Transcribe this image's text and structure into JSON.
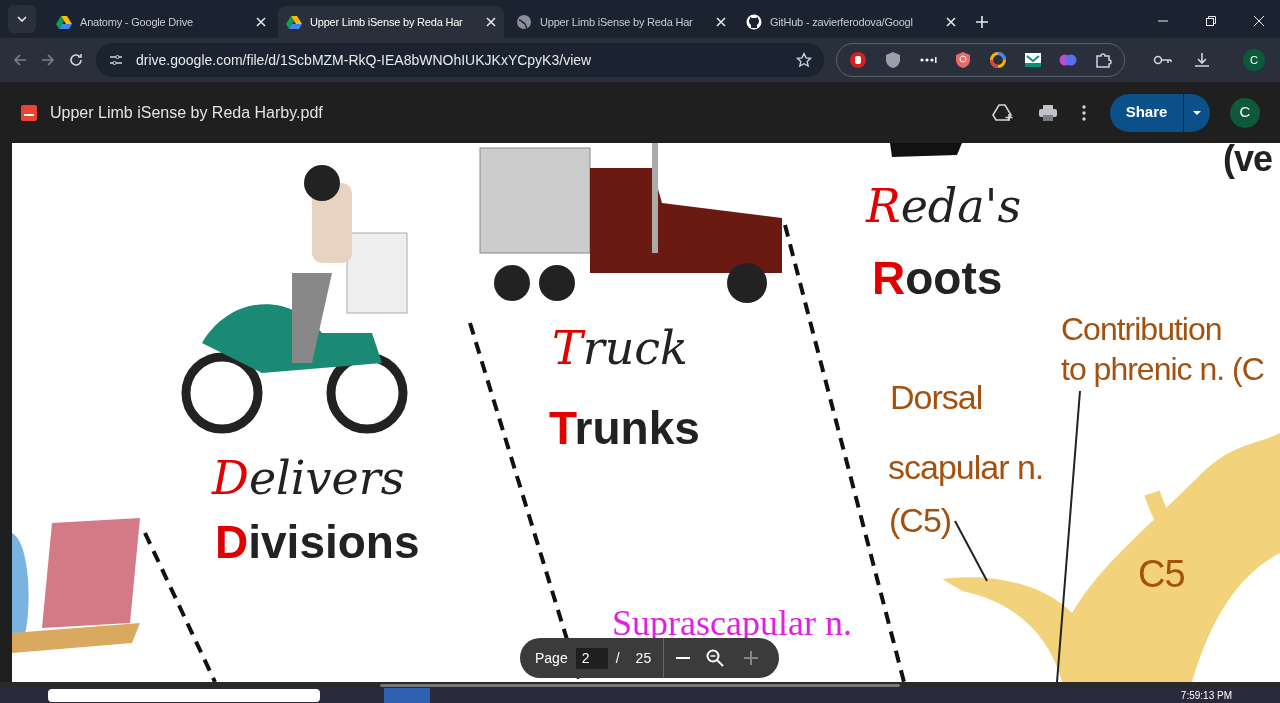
{
  "tabs": [
    {
      "title": "Anatomy - Google Drive",
      "kind": "drive",
      "selected": false
    },
    {
      "title": "Upper Limb iSense by Reda Har",
      "kind": "drive",
      "selected": true
    },
    {
      "title": "Upper Limb iSense by Reda Har",
      "kind": "globe",
      "selected": false
    },
    {
      "title": "GitHub - zavierferodova/Googl",
      "kind": "github",
      "selected": false
    }
  ],
  "address_bar": {
    "url": "drive.google.com/file/d/1ScbMZM-RkQ-IEA8bWNOhIUKJKxYCpyK3/view"
  },
  "extensions": [
    {
      "kind": "hand"
    },
    {
      "kind": "shield"
    },
    {
      "kind": "dots"
    },
    {
      "kind": "shield-red"
    },
    {
      "kind": "ring"
    },
    {
      "kind": "mail"
    },
    {
      "kind": "brain"
    },
    {
      "kind": "puzzle"
    }
  ],
  "profile_initial": "C",
  "viewer": {
    "file_name": "Upper Limb iSense by Reda Harby.pdf",
    "share_label": "Share",
    "avatar_initial": "C"
  },
  "page_texts": [
    {
      "kind": "script",
      "text": "Delivers",
      "color": "#222222",
      "initial": {
        "color": "#e00000"
      }
    },
    {
      "kind": "heading",
      "text": "Divisions",
      "color": "#222222",
      "initial": {
        "color": "#e00000"
      }
    },
    {
      "kind": "script",
      "text": "Truck",
      "color": "#222222",
      "initial": {
        "color": "#e00000"
      }
    },
    {
      "kind": "heading",
      "text": "Trunks",
      "color": "#222222",
      "initial": {
        "color": "#e00000"
      }
    },
    {
      "kind": "script",
      "text": "Reda's",
      "color": "#222222",
      "initial": {
        "color": "#e00000"
      }
    },
    {
      "kind": "heading",
      "text": "Roots",
      "color": "#222222",
      "initial": {
        "color": "#e00000"
      }
    },
    {
      "kind": "label",
      "text": "(ve",
      "color": "#222222"
    },
    {
      "kind": "label",
      "text": "Contribution",
      "color": "#a4510f"
    },
    {
      "kind": "label",
      "text": "to phrenic n. (C",
      "color": "#a4510f"
    },
    {
      "kind": "label",
      "text": "Dorsal",
      "color": "#a4510f"
    },
    {
      "kind": "label",
      "text": "scapular n.",
      "color": "#a4510f"
    },
    {
      "kind": "label",
      "text": "(C5)",
      "color": "#a4510f"
    },
    {
      "kind": "label",
      "text": "C5",
      "color": "#a4510f"
    },
    {
      "kind": "serif",
      "text": "Suprascapular n.",
      "color": "#e020e0"
    }
  ],
  "page_controls": {
    "label": "Page",
    "current": "2",
    "separator": "/",
    "total": "25"
  },
  "taskbar": {
    "time": "7:59:13 PM"
  }
}
